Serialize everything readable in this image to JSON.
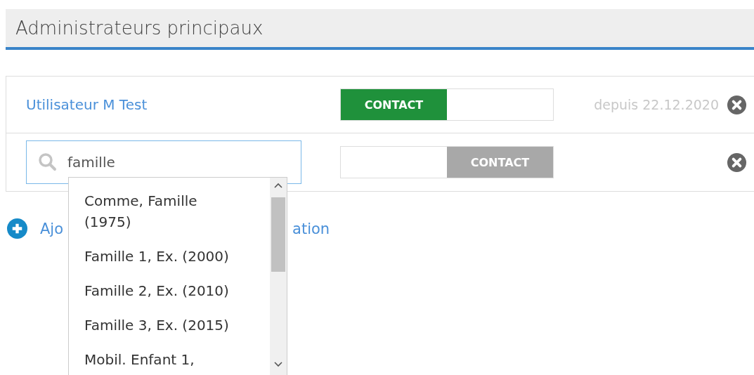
{
  "section": {
    "title": "Administrateurs principaux"
  },
  "rows": [
    {
      "kind": "user",
      "name": "Utilisateur M Test",
      "contact": {
        "label": "CONTACT",
        "on": true
      },
      "since": "depuis 22.12.2020"
    },
    {
      "kind": "search",
      "value": "famille",
      "contact": {
        "label": "CONTACT",
        "on": false
      }
    }
  ],
  "add_link": {
    "start": "Ajo",
    "end": "ation"
  },
  "dropdown": {
    "items": [
      {
        "label": "Comme, Famille (1975)"
      },
      {
        "label": "Famille 1, Ex. (2000)"
      },
      {
        "label": "Famille 2, Ex. (2010)"
      },
      {
        "label": "Famille 3, Ex. (2015)"
      },
      {
        "label": "Mobil. Enfant 1,"
      }
    ]
  }
}
